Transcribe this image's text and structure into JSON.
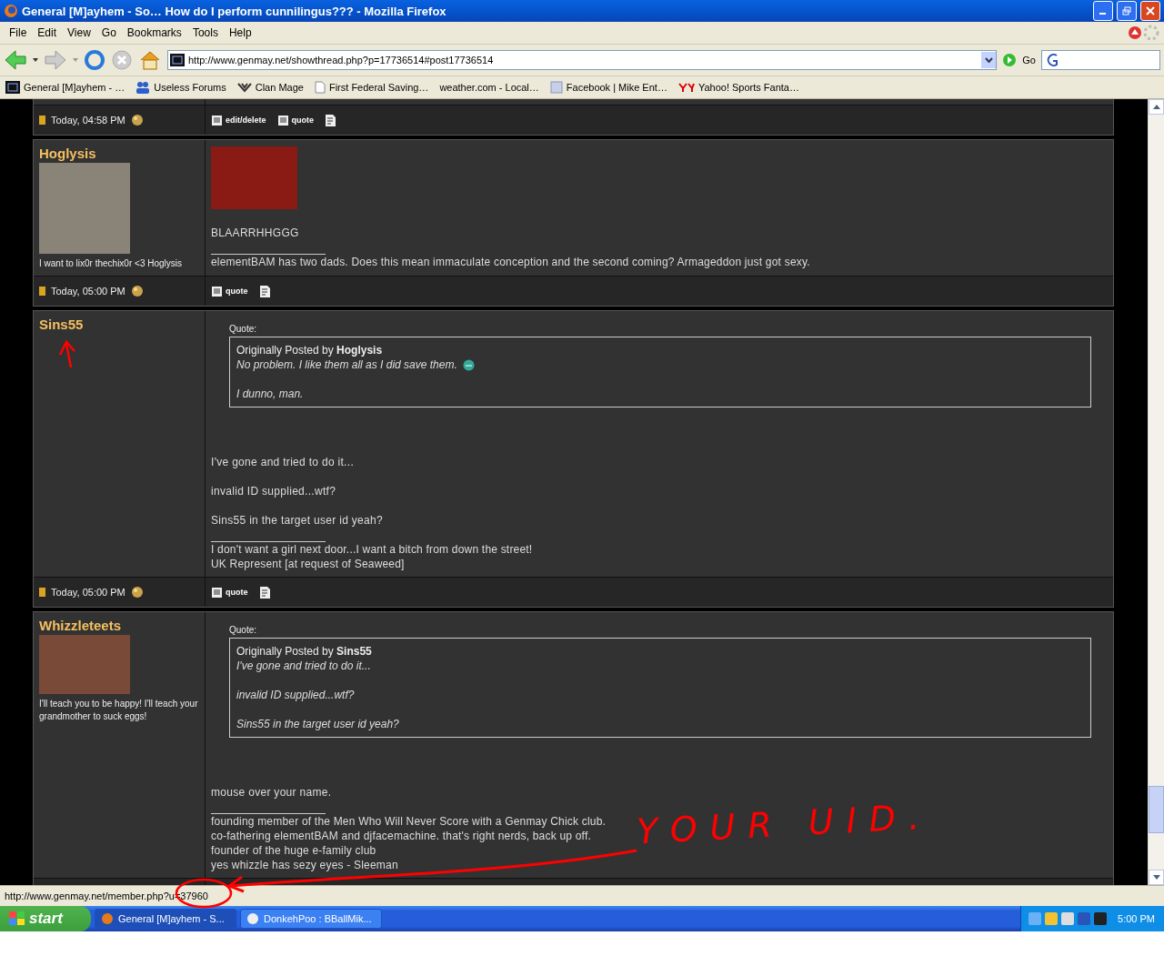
{
  "window": {
    "title": "General [M]ayhem - So… How do I perform cunnilingus??? - Mozilla Firefox"
  },
  "menu": [
    "File",
    "Edit",
    "View",
    "Go",
    "Bookmarks",
    "Tools",
    "Help"
  ],
  "address": {
    "url": "http://www.genmay.net/showthread.php?p=17736514#post17736514",
    "go": "Go"
  },
  "bookmarks": [
    {
      "label": "General [M]ayhem - …",
      "kind": "site"
    },
    {
      "label": "Useless Forums",
      "kind": "people"
    },
    {
      "label": "Clan Mage",
      "kind": "clan"
    },
    {
      "label": "First Federal Saving…",
      "kind": "page"
    },
    {
      "label": "weather.com - Local…",
      "kind": "none"
    },
    {
      "label": "Facebook | Mike Ent…",
      "kind": "facebook"
    },
    {
      "label": "Yahoo! Sports Fanta…",
      "kind": "yahoo"
    }
  ],
  "thread": {
    "top_footer": {
      "date": "Today, 04:58 PM",
      "actions": [
        "edit/delete",
        "quote"
      ]
    },
    "posts": [
      {
        "username": "Hoglysis",
        "avatar": true,
        "user_title": "I want to lix0r thechix0r <3 Hoglysis",
        "image": true,
        "message": [
          {
            "text": "BLAARRHHGGG"
          }
        ],
        "signature": [
          "elementBAM has two dads. Does this mean immaculate conception and the second coming? Armageddon just got sexy."
        ],
        "footer": {
          "date": "Today, 05:00 PM",
          "actions": [
            "quote"
          ]
        }
      },
      {
        "username": "Sins55",
        "avatar": false,
        "quote": {
          "label": "Quote:",
          "author_line": "Originally Posted by **Hoglysis**",
          "paragraphs": [
            {
              "text": "No problem. I like them all as I did save them.",
              "smiley": true
            },
            {
              "text": "I dunno, man.",
              "smiley": false
            }
          ]
        },
        "message": [
          {
            "text": "I've gone and tried to do it..."
          },
          {
            "text": "invalid ID supplied...wtf?"
          },
          {
            "text": "Sins55 in the target user id yeah?"
          }
        ],
        "signature": [
          "I don't want a girl next door...I want a bitch from down the street!",
          "UK Represent [at request of Seaweed]"
        ],
        "footer": {
          "date": "Today, 05:00 PM",
          "actions": [
            "quote"
          ]
        }
      },
      {
        "username": "Whizzleteets",
        "avatar": true,
        "user_title": "I'll teach you to be happy! I'll teach your grandmother to suck eggs!",
        "quote": {
          "label": "Quote:",
          "author_line": "Originally Posted by **Sins55**",
          "paragraphs": [
            {
              "text": "I've gone and tried to do it...",
              "smiley": false
            },
            {
              "text": "invalid ID supplied...wtf?",
              "smiley": false
            },
            {
              "text": "Sins55 in the target user id yeah?",
              "smiley": false
            }
          ]
        },
        "message": [
          {
            "text": "mouse over your name."
          }
        ],
        "signature": [
          "founding member of the Men Who Will Never Score with a Genmay Chick club.",
          "co-fathering elementBAM and djfacemachine. that's right nerds, back up off.",
          "founder of the huge e-family club",
          "yes whizzle has sezy eyes - Sleeman"
        ]
      }
    ]
  },
  "status": "http://www.genmay.net/member.php?u=37960",
  "taskbar": {
    "start": "start",
    "tasks": [
      {
        "label": "General [M]ayhem - S...",
        "selected": true
      },
      {
        "label": "DonkehPoo : BBallMik...",
        "selected": false
      }
    ],
    "clock": "5:00 PM"
  },
  "annotation": {
    "text": "YOUR UID."
  }
}
